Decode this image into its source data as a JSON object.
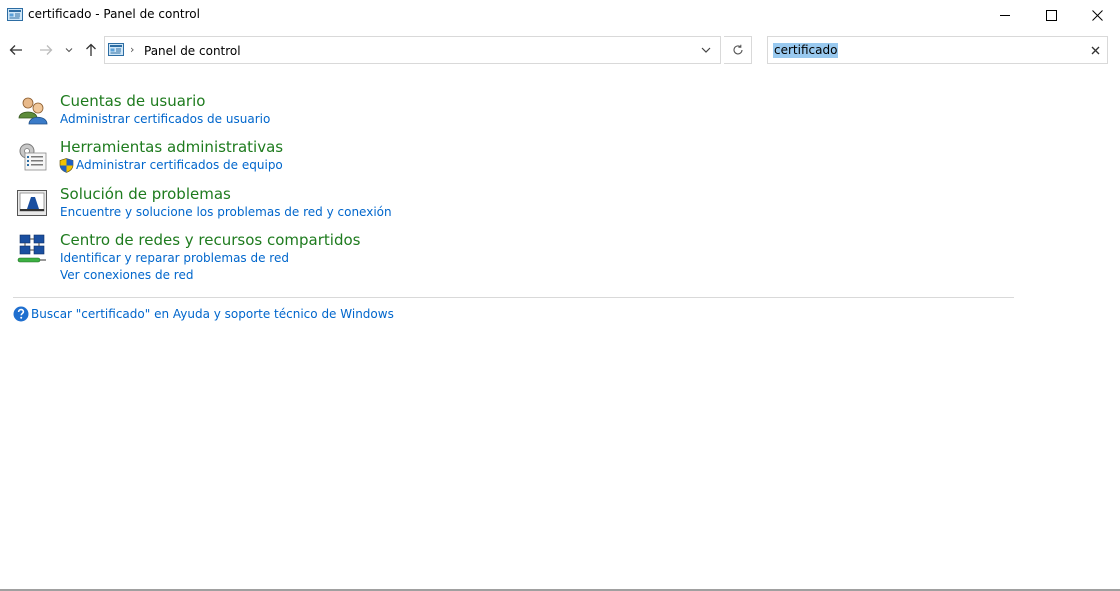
{
  "window": {
    "title": "certificado - Panel de control",
    "controls": [
      "minimize-icon",
      "maximize-icon",
      "close-icon"
    ]
  },
  "navigation": {
    "back_icon": "arrow-left-icon",
    "forward_icon": "arrow-right-icon",
    "recent_icon": "chevron-down-icon",
    "up_icon": "arrow-up-icon",
    "address": {
      "icon": "control-panel-icon",
      "separator": "›",
      "path": "Panel de control"
    },
    "refresh_icon": "refresh-icon",
    "search": {
      "value": "certificado",
      "clear_icon": "close-icon"
    }
  },
  "results": [
    {
      "title": "Cuentas de usuario",
      "icon": "user-accounts-icon",
      "links": [
        {
          "label": "Administrar certificados de usuario",
          "shield": false
        }
      ]
    },
    {
      "title": "Herramientas administrativas",
      "icon": "admin-tools-icon",
      "links": [
        {
          "label": "Administrar certificados de equipo",
          "shield": true
        }
      ]
    },
    {
      "title": "Solución de problemas",
      "icon": "troubleshooting-icon",
      "links": [
        {
          "label": "Encuentre y solucione los problemas de red y conexión",
          "shield": false
        }
      ]
    },
    {
      "title": "Centro de redes y recursos compartidos",
      "icon": "network-center-icon",
      "links": [
        {
          "label": "Identificar y reparar problemas de red",
          "shield": false
        },
        {
          "label": "Ver conexiones de red",
          "shield": false
        }
      ]
    }
  ],
  "help": {
    "icon": "help-icon",
    "label": "Buscar \"certificado\" en Ayuda y soporte técnico de Windows"
  },
  "colors": {
    "category_title": "#1e7b1e",
    "link": "#0066cc",
    "search_highlight": "#99c9ef"
  }
}
